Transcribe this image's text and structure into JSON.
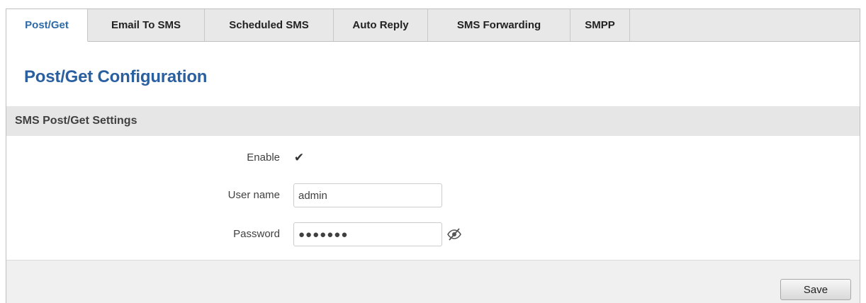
{
  "tabs": [
    {
      "label": "Post/Get",
      "active": true
    },
    {
      "label": "Email To SMS",
      "active": false
    },
    {
      "label": "Scheduled SMS",
      "active": false
    },
    {
      "label": "Auto Reply",
      "active": false
    },
    {
      "label": "SMS Forwarding",
      "active": false
    },
    {
      "label": "SMPP",
      "active": false
    }
  ],
  "page": {
    "title": "Post/Get Configuration"
  },
  "section": {
    "title": "SMS Post/Get Settings"
  },
  "form": {
    "enable": {
      "label": "Enable",
      "checked": true
    },
    "username": {
      "label": "User name",
      "value": "admin"
    },
    "password": {
      "label": "Password",
      "value": "●●●●●●●"
    }
  },
  "footer": {
    "save_label": "Save"
  },
  "icons": {
    "checkbox": "check-icon",
    "password_toggle": "eye-slash-icon"
  },
  "colors": {
    "accent": "#2a5fa0",
    "active_tab_text": "#2d6aa8",
    "tab_bar_bg": "#e8e8e8",
    "section_header_bg": "#e6e6e6"
  }
}
